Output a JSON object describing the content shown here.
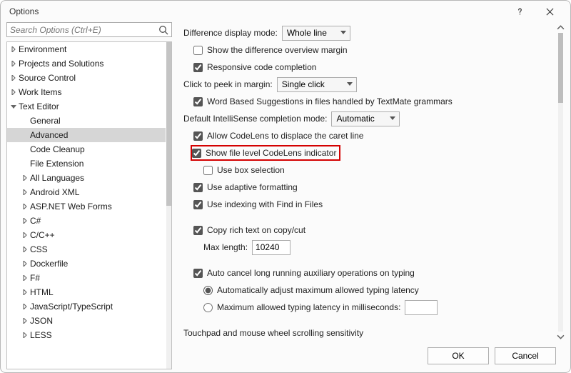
{
  "window": {
    "title": "Options"
  },
  "search": {
    "placeholder": "Search Options (Ctrl+E)"
  },
  "tree": [
    {
      "label": "Environment",
      "level": 0,
      "caret": "right"
    },
    {
      "label": "Projects and Solutions",
      "level": 0,
      "caret": "right"
    },
    {
      "label": "Source Control",
      "level": 0,
      "caret": "right"
    },
    {
      "label": "Work Items",
      "level": 0,
      "caret": "right"
    },
    {
      "label": "Text Editor",
      "level": 0,
      "caret": "down"
    },
    {
      "label": "General",
      "level": 1,
      "caret": ""
    },
    {
      "label": "Advanced",
      "level": 1,
      "caret": "",
      "selected": true
    },
    {
      "label": "Code Cleanup",
      "level": 1,
      "caret": ""
    },
    {
      "label": "File Extension",
      "level": 1,
      "caret": ""
    },
    {
      "label": "All Languages",
      "level": 1,
      "caret": "right"
    },
    {
      "label": "Android XML",
      "level": 1,
      "caret": "right"
    },
    {
      "label": "ASP.NET Web Forms",
      "level": 1,
      "caret": "right"
    },
    {
      "label": "C#",
      "level": 1,
      "caret": "right"
    },
    {
      "label": "C/C++",
      "level": 1,
      "caret": "right"
    },
    {
      "label": "CSS",
      "level": 1,
      "caret": "right"
    },
    {
      "label": "Dockerfile",
      "level": 1,
      "caret": "right"
    },
    {
      "label": "F#",
      "level": 1,
      "caret": "right"
    },
    {
      "label": "HTML",
      "level": 1,
      "caret": "right"
    },
    {
      "label": "JavaScript/TypeScript",
      "level": 1,
      "caret": "right"
    },
    {
      "label": "JSON",
      "level": 1,
      "caret": "right"
    },
    {
      "label": "LESS",
      "level": 1,
      "caret": "right"
    }
  ],
  "panel": {
    "diff_mode_label": "Difference display mode:",
    "diff_mode_value": "Whole line",
    "show_diff_overview": {
      "label": "Show the difference overview margin",
      "checked": false
    },
    "responsive_completion": {
      "label": "Responsive code completion",
      "checked": true
    },
    "peek_label": "Click to peek in margin:",
    "peek_value": "Single click",
    "word_based": {
      "label": "Word Based Suggestions in files handled by TextMate grammars",
      "checked": true
    },
    "intellisense_label": "Default IntelliSense completion mode:",
    "intellisense_value": "Automatic",
    "codelens_caret": {
      "label": "Allow CodeLens to displace the caret line",
      "checked": true
    },
    "codelens_indicator": {
      "label": "Show file level CodeLens indicator",
      "checked": true
    },
    "box_selection": {
      "label": "Use box selection",
      "checked": false
    },
    "adaptive_fmt": {
      "label": "Use adaptive formatting",
      "checked": true
    },
    "indexing_find": {
      "label": "Use indexing with Find in Files",
      "checked": true
    },
    "copy_rich": {
      "label": "Copy rich text on copy/cut",
      "checked": true
    },
    "max_len_label": "Max length:",
    "max_len_value": "10240",
    "auto_cancel": {
      "label": "Auto cancel long running auxiliary operations on typing",
      "checked": true
    },
    "radio_auto": "Automatically adjust maximum allowed typing latency",
    "radio_ms": "Maximum allowed typing latency in milliseconds:",
    "radio_ms_value": "",
    "touchpad_label": "Touchpad and mouse wheel scrolling sensitivity"
  },
  "buttons": {
    "ok": "OK",
    "cancel": "Cancel"
  }
}
